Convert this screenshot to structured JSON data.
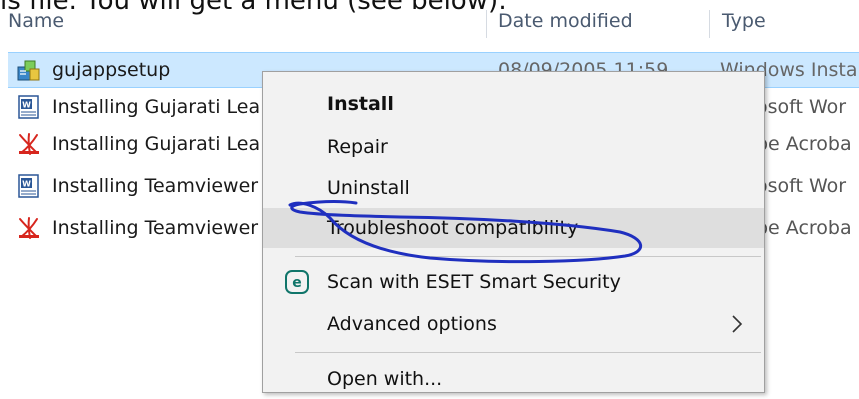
{
  "instruction": {
    "text": "is file.  You will get a menu (see below):"
  },
  "columns": {
    "name": "Name",
    "date": "Date modified",
    "type": "Type"
  },
  "files": [
    {
      "name": "gujappsetup",
      "date": "08/09/2005 11:59",
      "type": "Windows Insta",
      "icon": "installer-icon"
    },
    {
      "name": "Installing Gujarati Lea",
      "type_tail": "osoft Wor",
      "icon": "word-document-icon"
    },
    {
      "name": "Installing Gujarati Lea",
      "type_tail": "be Acroba",
      "icon": "pdf-document-icon"
    },
    {
      "name": "Installing Teamviewer",
      "type_tail": "osoft Wor",
      "icon": "word-document-icon"
    },
    {
      "name": "Installing Teamviewer",
      "type_tail": "be Acroba",
      "icon": "pdf-document-icon"
    }
  ],
  "context_menu": {
    "items": [
      {
        "label": "Install"
      },
      {
        "label": "Repair"
      },
      {
        "label": "Uninstall"
      },
      {
        "label": "Troubleshoot compatibility"
      },
      {
        "label": "Scan with ESET Smart Security",
        "icon": "eset-icon"
      },
      {
        "label": "Advanced options",
        "icon": "chevron-right-icon"
      },
      {
        "label": "Open with..."
      }
    ]
  },
  "colors": {
    "selection_bg": "#cce8ff",
    "menu_bg": "#f2f2f2",
    "hover_bg": "#dedede",
    "annotation": "#1f2fbf",
    "eset_green": "#10756a"
  }
}
